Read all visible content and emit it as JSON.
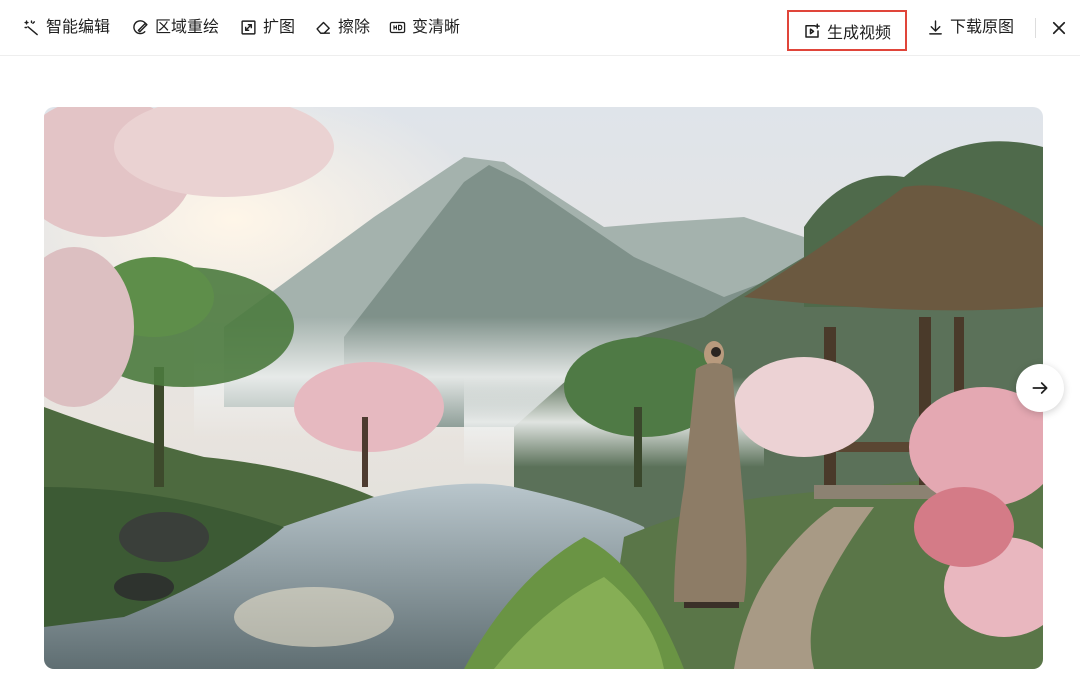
{
  "toolbar": {
    "smart_edit": "智能编辑",
    "region_redraw": "区域重绘",
    "expand": "扩图",
    "erase": "擦除",
    "sharpen": "变清晰",
    "generate_video": "生成视频",
    "download": "下载原图"
  },
  "colors": {
    "highlight_border": "#e0453a",
    "text": "#1f1f1f"
  },
  "image": {
    "description_hidden": true,
    "icon": "landscape-image"
  },
  "icons": {
    "smart_edit": "magic-wand-icon",
    "region_redraw": "brush-icon",
    "expand": "expand-icon",
    "erase": "eraser-icon",
    "sharpen": "hd-icon",
    "generate_video": "video-plus-icon",
    "download": "download-icon",
    "close": "close-icon",
    "next": "arrow-right-icon"
  }
}
